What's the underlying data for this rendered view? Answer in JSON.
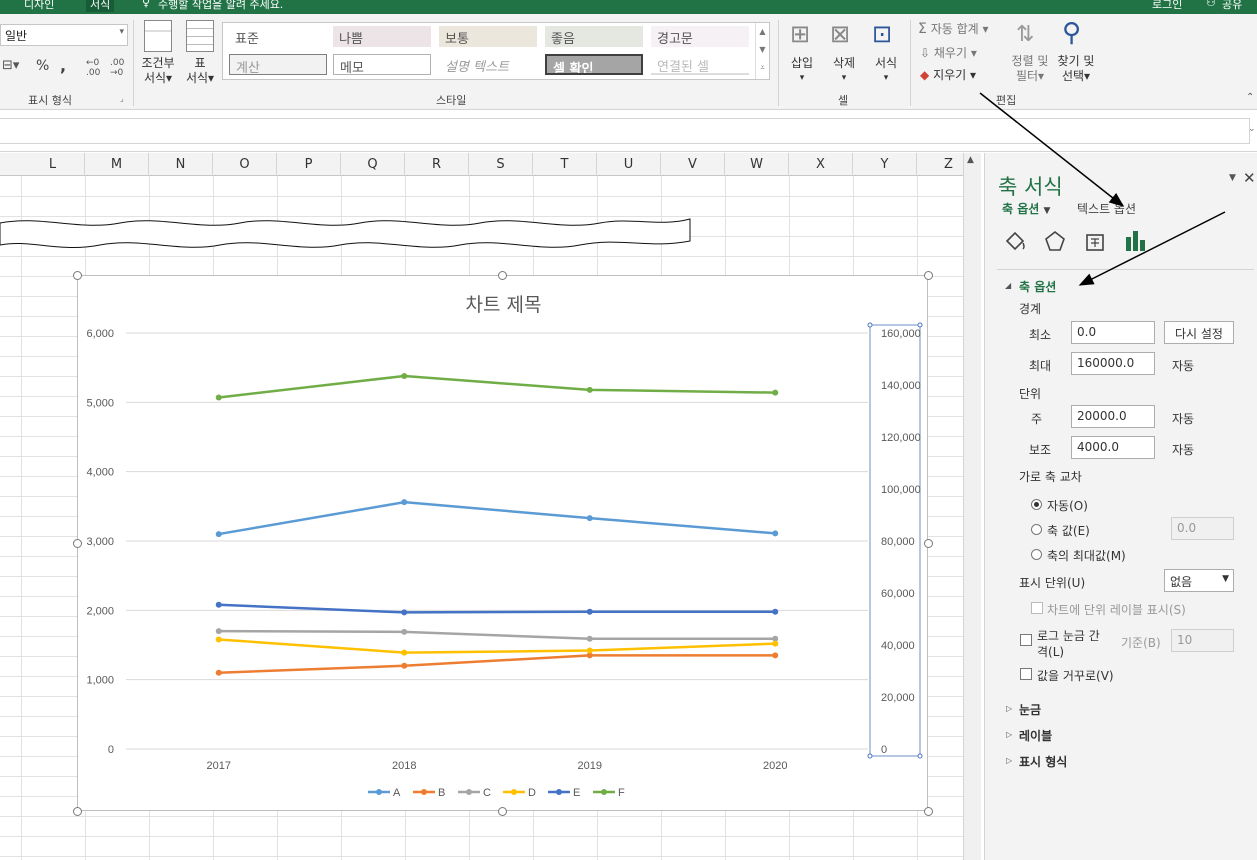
{
  "topbar": {
    "tab_design": "디자인",
    "tab_format": "서식",
    "tell_me": "수행할 작업을 알려 주세요.",
    "signin": "로그인",
    "share": "공유"
  },
  "ribbon": {
    "number_format_value": "일반",
    "percent": "%",
    "comma": ",",
    "number_group_label": "표시 형식",
    "conditional_format": "조건부",
    "conditional_format2": "서식",
    "format_table": "표",
    "format_table2": "서식",
    "styles": [
      "표준",
      "나쁨",
      "보통",
      "좋음",
      "경고문",
      "계산",
      "메모",
      "설명 텍스트",
      "셀 확인",
      "연결된 셀"
    ],
    "styles_group_label": "스타일",
    "insert": "삽입",
    "delete": "삭제",
    "format": "서식",
    "cells_group_label": "셀",
    "autosum": "자동 합계",
    "fill": "채우기",
    "clear": "지우기",
    "sort_filter": "정렬 및",
    "sort_filter2": "필터",
    "find_select": "찾기 및",
    "find_select2": "선택",
    "editing_group_label": "편집"
  },
  "columns": [
    "L",
    "M",
    "N",
    "O",
    "P",
    "Q",
    "R",
    "S",
    "T",
    "U",
    "V",
    "W",
    "X",
    "Y",
    "Z"
  ],
  "chart_data": {
    "type": "line",
    "title": "차트 제목",
    "categories": [
      "2017",
      "2018",
      "2019",
      "2020"
    ],
    "series": [
      {
        "name": "A",
        "color": "#5b9bd5",
        "values": [
          3100,
          3560,
          3330,
          3110
        ]
      },
      {
        "name": "B",
        "color": "#ed7d31",
        "values": [
          1100,
          1200,
          1350,
          1350
        ]
      },
      {
        "name": "C",
        "color": "#a5a5a5",
        "values": [
          1700,
          1690,
          1590,
          1590
        ]
      },
      {
        "name": "D",
        "color": "#ffc000",
        "values": [
          1580,
          1390,
          1420,
          1520
        ]
      },
      {
        "name": "E",
        "color": "#4472c4",
        "values": [
          2080,
          1970,
          1980,
          1980
        ]
      },
      {
        "name": "F",
        "color": "#70ad47",
        "values": [
          5070,
          5380,
          5180,
          5140
        ]
      }
    ],
    "primary_axis": {
      "min": 0,
      "max": 6000,
      "ticks": [
        "0",
        "1,000",
        "2,000",
        "3,000",
        "4,000",
        "5,000",
        "6,000"
      ]
    },
    "secondary_axis": {
      "min": 0,
      "max": 160000,
      "ticks": [
        "0",
        "20,000",
        "40,000",
        "60,000",
        "80,000",
        "100,000",
        "120,000",
        "140,000",
        "160,000"
      ]
    },
    "grid": true,
    "legend_position": "bottom"
  },
  "pane": {
    "title": "축 서식",
    "tab_axis_options": "축 옵션",
    "tab_text_options": "텍스트 옵션",
    "section_axis_options": "축 옵션",
    "bounds_label": "경계",
    "min_label": "최소",
    "min_value": "0.0",
    "reset_button": "다시 설정",
    "max_label": "최대",
    "max_value": "160000.0",
    "max_auto": "자동",
    "units_label": "단위",
    "major_label": "주",
    "major_value": "20000.0",
    "major_auto": "자동",
    "minor_label": "보조",
    "minor_value": "4000.0",
    "minor_auto": "자동",
    "cross_label": "가로 축 교차",
    "radio_auto": "자동(O)",
    "radio_axis_value": "축 값(E)",
    "axis_value_input": "0.0",
    "radio_max": "축의 최대값(M)",
    "display_units_label": "표시 단위(U)",
    "display_units_value": "없음",
    "show_units_label": "차트에 단위 레이블 표시(S)",
    "log_scale_label1": "로그 눈금 간",
    "log_scale_label2": "격(L)",
    "base_label": "기준(B)",
    "base_value": "10",
    "reverse_label": "값을 거꾸로(V)",
    "section_ticks": "눈금",
    "section_labels": "레이블",
    "section_number": "표시 형식"
  }
}
